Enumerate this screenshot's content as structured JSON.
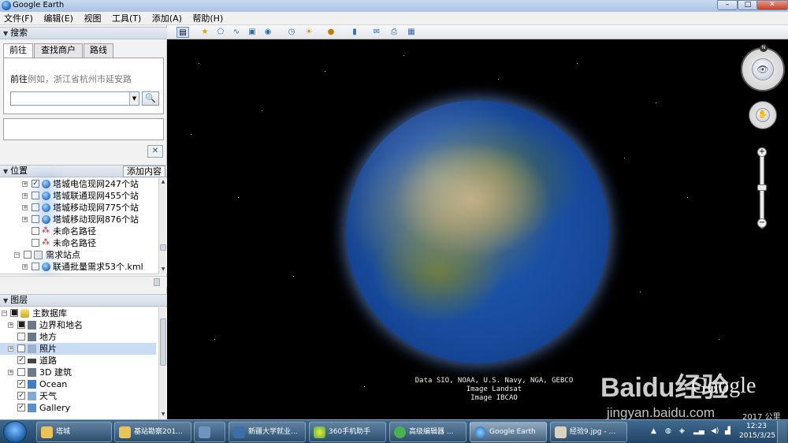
{
  "window": {
    "title": "Google Earth",
    "controls": [
      "–",
      "□",
      "✕"
    ]
  },
  "menu": [
    "文件(F)",
    "编辑(E)",
    "视图",
    "工具(T)",
    "添加(A)",
    "帮助(H)"
  ],
  "search": {
    "header": "搜索",
    "tabs": [
      "前往",
      "查找商户",
      "路线"
    ],
    "prompt": "前往",
    "example": "例如，浙江省杭州市延安路",
    "search_button": "🔍",
    "clear_button": "✕"
  },
  "places": {
    "header": "位置",
    "add_content": "添加内容",
    "items": [
      {
        "label": "塔城电信现网247个站",
        "checked": true,
        "icon": "globe"
      },
      {
        "label": "塔城联通现网455个站",
        "checked": false,
        "icon": "globe"
      },
      {
        "label": "塔城移动现网775个站",
        "checked": false,
        "icon": "globe"
      },
      {
        "label": "塔城移动现网876个站",
        "checked": false,
        "icon": "globe"
      },
      {
        "label": "未命名路径",
        "checked": false,
        "icon": "path"
      },
      {
        "label": "未命名路径",
        "checked": false,
        "icon": "path"
      },
      {
        "label": "需求站点",
        "checked": false,
        "icon": "folder"
      },
      {
        "label": "联通批量需求53个.kml",
        "checked": false,
        "icon": "globe"
      }
    ]
  },
  "layers": {
    "header": "图层",
    "items": [
      {
        "label": "主数据库",
        "checked": true,
        "icon": "db"
      },
      {
        "label": "边界和地名",
        "checked": true,
        "icon": "sq"
      },
      {
        "label": "地方",
        "checked": false,
        "icon": "sq"
      },
      {
        "label": "照片",
        "checked": false,
        "icon": "sq",
        "selected": true
      },
      {
        "label": "道路",
        "checked": true,
        "icon": "road"
      },
      {
        "label": "3D 建筑",
        "checked": false,
        "icon": "sq"
      },
      {
        "label": "Ocean",
        "checked": true,
        "icon": "sq"
      },
      {
        "label": "天气",
        "checked": true,
        "icon": "sq"
      },
      {
        "label": "Gallery",
        "checked": true,
        "icon": "sq"
      }
    ]
  },
  "toolbar_icons": [
    "sidebar-icon",
    "placemark-icon",
    "polygon-icon",
    "path-icon",
    "overlay-icon",
    "tour-icon",
    "history-icon",
    "sun-icon",
    "planet-icon",
    "ruler-icon",
    "email-icon",
    "print-icon",
    "maps-icon"
  ],
  "viewer": {
    "attribution": [
      "Data SIO, NOAA, U.S. Navy, NGA, GEBCO",
      "Image Landsat",
      "Image IBCAO"
    ],
    "logo": "Google",
    "watermark": "Baidu经验",
    "watermark_url": "jingyan.baidu.com",
    "scale_text": "2017  公里",
    "north": "N",
    "zoom_in": "+",
    "zoom_out": "−"
  },
  "taskbar": {
    "items": [
      "塔城",
      "基站勘察201...",
      "",
      "新疆大学就业...",
      "360手机助手",
      "高级编辑器 ...",
      "Google Earth",
      "经验9.jpg - ..."
    ],
    "active_index": 6,
    "time": "12:23",
    "date": "2015/3/25"
  }
}
